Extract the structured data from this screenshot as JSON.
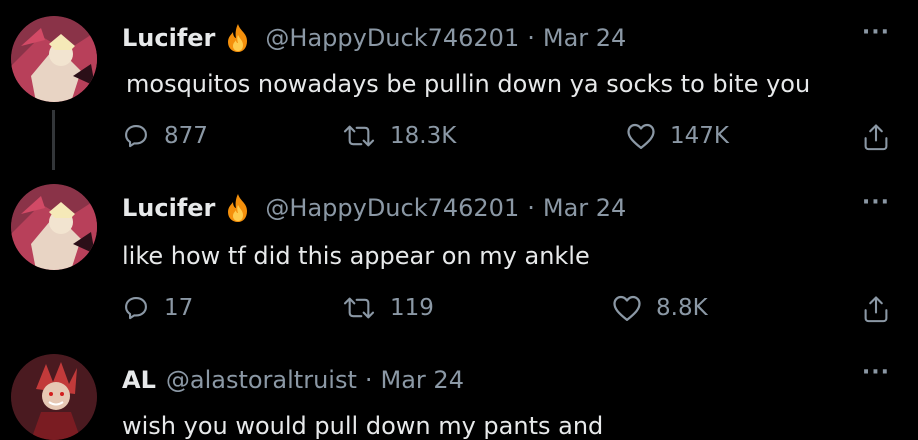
{
  "tweets": [
    {
      "name": "Lucifer",
      "badge": "fire-emoji",
      "handle": "@HappyDuck746201",
      "separator": "·",
      "date": "Mar 24",
      "more": "···",
      "text": "mosquitos nowadays be pullin down ya socks to bite you",
      "replies": "877",
      "retweets": "18.3K",
      "likes": "147K"
    },
    {
      "name": "Lucifer",
      "badge": "fire-emoji",
      "handle": "@HappyDuck746201",
      "separator": "·",
      "date": "Mar 24",
      "more": "···",
      "text": "like how tf did this appear on my ankle",
      "replies": "17",
      "retweets": "119",
      "likes": "8.8K"
    },
    {
      "name": "AL",
      "handle": "@alastoraltruist",
      "separator": "·",
      "date": "Mar 24",
      "more": "···",
      "text": "wish you would pull down my pants and"
    }
  ],
  "icons": {
    "reply": "reply-icon",
    "retweet": "retweet-icon",
    "like": "heart-icon",
    "share": "share-icon"
  },
  "colors": {
    "background": "#000000",
    "text": "#e7e9ea",
    "secondary": "#8b98a5",
    "thread_line": "#333639"
  }
}
